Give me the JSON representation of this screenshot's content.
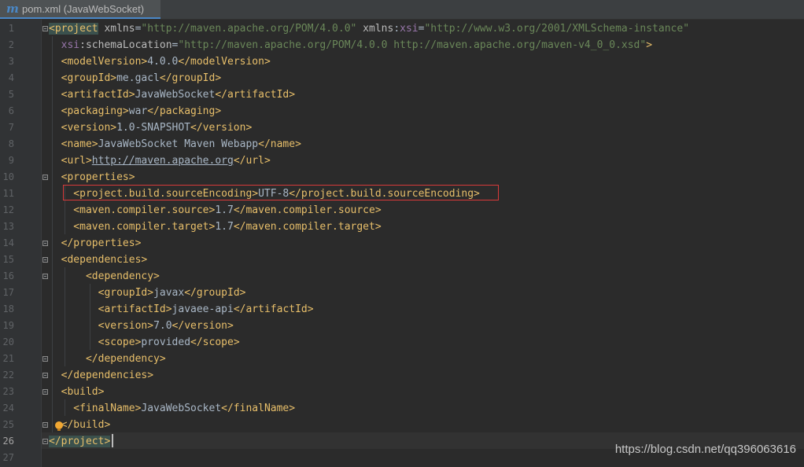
{
  "editor_tab": {
    "icon": "maven-m-icon",
    "icon_glyph": "m",
    "title": "pom.xml (JavaWebSocket)"
  },
  "current_line": 26,
  "lines": [
    [
      [
        "<project",
        "tag hl-tag"
      ],
      [
        " xmlns",
        "attr"
      ],
      [
        "=",
        "txt"
      ],
      [
        "\"http://maven.apache.org/POM/4.0.0\"",
        "str"
      ],
      [
        " xmlns",
        "attr"
      ],
      [
        ":",
        "txt"
      ],
      [
        "xsi",
        "ns"
      ],
      [
        "=",
        "txt"
      ],
      [
        "\"http://www.w3.org/2001/XMLSchema-instance\"",
        "str"
      ]
    ],
    [
      [
        "  xsi",
        "ns"
      ],
      [
        ":schemaLocation",
        "attr"
      ],
      [
        "=",
        "txt"
      ],
      [
        "\"http://maven.apache.org/POM/4.0.0 http://maven.apache.org/maven-v4_0_0.xsd\"",
        "str"
      ],
      [
        ">",
        "tag"
      ]
    ],
    [
      [
        "  <modelVersion>",
        "tag"
      ],
      [
        "4.0.0",
        "txt"
      ],
      [
        "</modelVersion>",
        "tag"
      ]
    ],
    [
      [
        "  <groupId>",
        "tag"
      ],
      [
        "me.gacl",
        "txt"
      ],
      [
        "</groupId>",
        "tag"
      ]
    ],
    [
      [
        "  <artifactId>",
        "tag"
      ],
      [
        "JavaWebSocket",
        "txt"
      ],
      [
        "</artifactId>",
        "tag"
      ]
    ],
    [
      [
        "  <packaging>",
        "tag"
      ],
      [
        "war",
        "txt"
      ],
      [
        "</packaging>",
        "tag"
      ]
    ],
    [
      [
        "  <version>",
        "tag"
      ],
      [
        "1.0-SNAPSHOT",
        "txt"
      ],
      [
        "</version>",
        "tag"
      ]
    ],
    [
      [
        "  <name>",
        "tag"
      ],
      [
        "JavaWebSocket Maven Webapp",
        "txt"
      ],
      [
        "</name>",
        "tag"
      ]
    ],
    [
      [
        "  <url>",
        "tag"
      ],
      [
        "http://maven.apache.org",
        "link"
      ],
      [
        "</url>",
        "tag"
      ]
    ],
    [
      [
        "  <properties>",
        "tag"
      ]
    ],
    [
      [
        "    <project.build.sourceEncoding>",
        "tag"
      ],
      [
        "UTF-8",
        "txt"
      ],
      [
        "</project.build.sourceEncoding>",
        "tag"
      ]
    ],
    [
      [
        "    <maven.compiler.source>",
        "tag"
      ],
      [
        "1.7",
        "txt"
      ],
      [
        "</maven.compiler.source>",
        "tag"
      ]
    ],
    [
      [
        "    <maven.compiler.target>",
        "tag"
      ],
      [
        "1.7",
        "txt"
      ],
      [
        "</maven.compiler.target>",
        "tag"
      ]
    ],
    [
      [
        "  </properties>",
        "tag"
      ]
    ],
    [
      [
        "  <dependencies>",
        "tag"
      ]
    ],
    [
      [
        "      <dependency>",
        "tag"
      ]
    ],
    [
      [
        "        <groupId>",
        "tag"
      ],
      [
        "javax",
        "txt"
      ],
      [
        "</groupId>",
        "tag"
      ]
    ],
    [
      [
        "        <artifactId>",
        "tag"
      ],
      [
        "javaee-api",
        "txt"
      ],
      [
        "</artifactId>",
        "tag"
      ]
    ],
    [
      [
        "        <version>",
        "tag"
      ],
      [
        "7.0",
        "txt"
      ],
      [
        "</version>",
        "tag"
      ]
    ],
    [
      [
        "        <scope>",
        "tag"
      ],
      [
        "provided",
        "txt"
      ],
      [
        "</scope>",
        "tag"
      ]
    ],
    [
      [
        "      </dependency>",
        "tag"
      ]
    ],
    [
      [
        "  </dependencies>",
        "tag"
      ]
    ],
    [
      [
        "  <build>",
        "tag"
      ]
    ],
    [
      [
        "    <finalName>",
        "tag"
      ],
      [
        "JavaWebSocket",
        "txt"
      ],
      [
        "</finalName>",
        "tag"
      ]
    ],
    [
      [
        "  </build>",
        "tag"
      ]
    ],
    [
      [
        "</project>",
        "tag hl-tag"
      ]
    ],
    []
  ],
  "highlighted_line": 11,
  "watermark": "https://blog.csdn.net/qq396063616"
}
